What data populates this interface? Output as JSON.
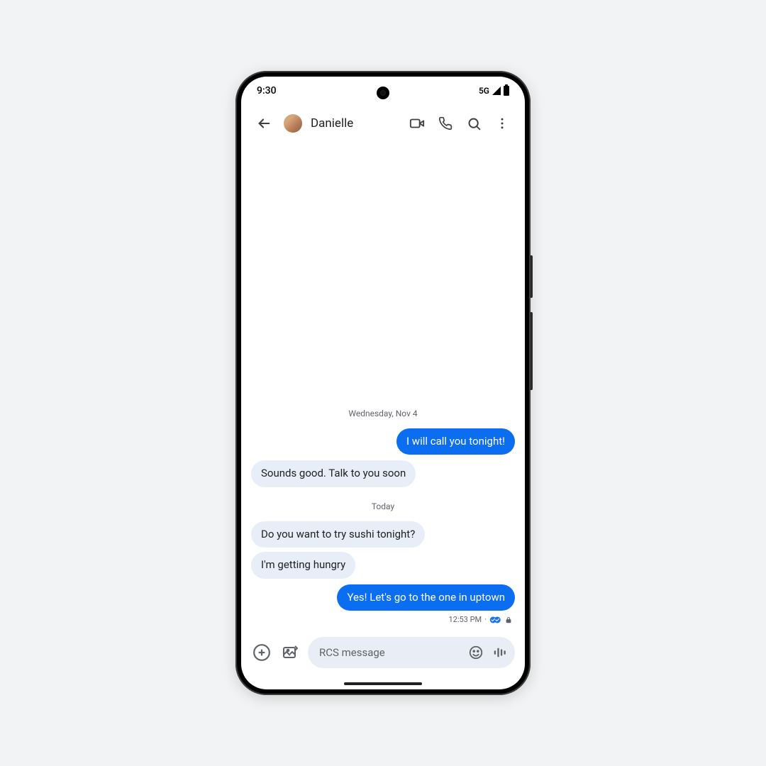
{
  "status": {
    "time": "9:30",
    "network": "5G"
  },
  "header": {
    "contact_name": "Danielle"
  },
  "conversation": {
    "date_1": "Wednesday, Nov 4",
    "msg_out_1": "I will call you tonight!",
    "msg_in_1": "Sounds good. Talk to you soon",
    "date_2": "Today",
    "msg_in_2": "Do you want to try sushi tonight?",
    "msg_in_3": "I'm getting hungry",
    "msg_out_2": "Yes! Let's go to the one in uptown",
    "last_time": "12:53 PM",
    "last_sep": "·"
  },
  "compose": {
    "placeholder": "RCS message"
  }
}
